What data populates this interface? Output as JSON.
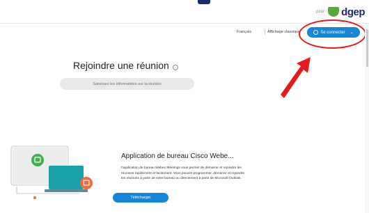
{
  "brand": {
    "pour_text": "pour",
    "name": "dgep",
    "color": "#1a2a6a",
    "shield_color": "#5aa83c"
  },
  "header": {
    "language": "Français",
    "classic_view": "Affichage classique",
    "sign_in_label": "Se connecter",
    "sign_in_icon": "user-circle-icon",
    "sign_in_chevron": "⌄",
    "accent": "#1686d9"
  },
  "annotation": {
    "color": "#e5191e",
    "shape": "ellipse-and-arrow"
  },
  "join": {
    "title": "Rejoindre une réunion",
    "info_icon": "i",
    "placeholder": "Saisissez les informations sur la réunion"
  },
  "desktop_app": {
    "title": "Application de bureau Cisco Webe...",
    "description": "l'application de bureau Webex Meetings vous permet de démarrer et rejoindre les réunions rapidement et facilement. Vous pouvez programmer, démarrer et rejoindre les réunions à partir de votre bureau ou directement à partir de Microsoft Outlook.",
    "download_label": "Télécharger"
  }
}
